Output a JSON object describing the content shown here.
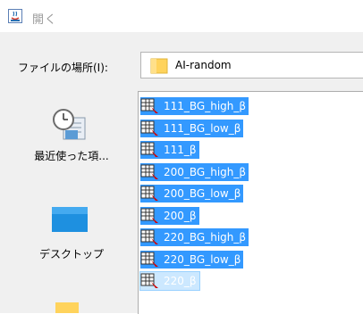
{
  "window": {
    "title": "開く"
  },
  "lookin": {
    "label": "ファイルの場所(I):",
    "value": "AI-random"
  },
  "places": [
    {
      "label": "最近使った項..."
    },
    {
      "label": "デスクトップ"
    }
  ],
  "files": [
    {
      "name": "111_BG_high_β"
    },
    {
      "name": "111_BG_low_β"
    },
    {
      "name": "111_β"
    },
    {
      "name": "200_BG_high_β"
    },
    {
      "name": "200_BG_low_β"
    },
    {
      "name": "200_β"
    },
    {
      "name": "220_BG_high_β"
    },
    {
      "name": "220_BG_low_β"
    },
    {
      "name": "220_β"
    }
  ],
  "colors": {
    "selection": "#3399ff",
    "folder": "#ffd35c"
  }
}
